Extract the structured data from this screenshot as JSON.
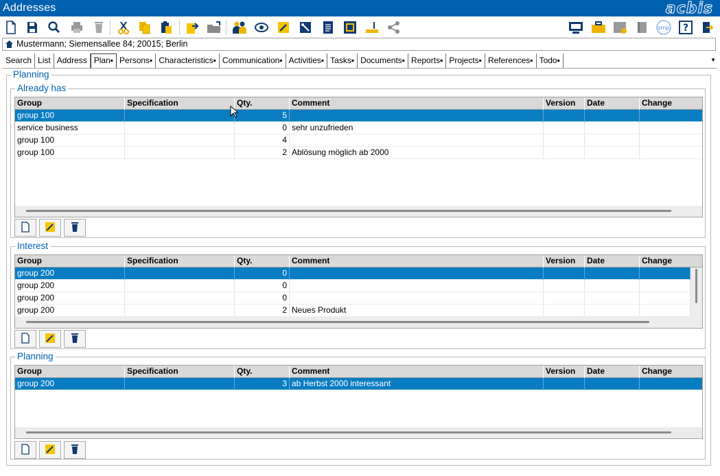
{
  "window": {
    "title": "Addresses",
    "brand": "acbis"
  },
  "breadcrumb": "Mustermann; Siemensallee 84; 20015; Berlin",
  "tabs": [
    "Search",
    "List",
    "Address",
    "Plan▪",
    "Persons▪",
    "Characteristics▪",
    "Communication▪",
    "Activities▪",
    "Tasks▪",
    "Documents▪",
    "Reports▪",
    "Projects▪",
    "References▪",
    "Todo▪"
  ],
  "active_tab": "Plan▪",
  "outer_title": "Planning",
  "columns": [
    "Group",
    "Specification",
    "Qty.",
    "Comment",
    "Version",
    "Date",
    "Change"
  ],
  "sections": {
    "already": {
      "title": "Already has",
      "rows": [
        {
          "group": "group 100",
          "spec": "",
          "qty": "5",
          "comment": "",
          "version": "",
          "date": "",
          "change": ""
        },
        {
          "group": "service business",
          "spec": "",
          "qty": "0",
          "comment": "sehr unzufrieden",
          "version": "",
          "date": "",
          "change": ""
        },
        {
          "group": "group 100",
          "spec": "",
          "qty": "4",
          "comment": "",
          "version": "",
          "date": "",
          "change": ""
        },
        {
          "group": "group 100",
          "spec": "",
          "qty": "2",
          "comment": "Ablösung möglich ab 2000",
          "version": "",
          "date": "",
          "change": ""
        }
      ]
    },
    "interest": {
      "title": "Interest",
      "rows": [
        {
          "group": "group  200",
          "spec": "",
          "qty": "0",
          "comment": "",
          "version": "",
          "date": "",
          "change": ""
        },
        {
          "group": "group  200",
          "spec": "",
          "qty": "0",
          "comment": "",
          "version": "",
          "date": "",
          "change": ""
        },
        {
          "group": "group  200",
          "spec": "",
          "qty": "0",
          "comment": "",
          "version": "",
          "date": "",
          "change": ""
        },
        {
          "group": "group  200",
          "spec": "",
          "qty": "2",
          "comment": "Neues Produkt",
          "version": "",
          "date": "",
          "change": ""
        }
      ]
    },
    "planning": {
      "title": "Planning",
      "rows": [
        {
          "group": "group  200",
          "spec": "",
          "qty": "3",
          "comment": "ab Herbst 2000 interessant",
          "version": "",
          "date": "",
          "change": ""
        }
      ]
    }
  },
  "toolbar_icons": [
    "new-document-icon",
    "save-icon",
    "search-icon",
    "print-icon",
    "delete-icon",
    "cut-icon",
    "copy-icon",
    "paste-icon",
    "export-icon",
    "open-folder-icon",
    "users-icon",
    "view-icon",
    "edit-icon",
    "tools-icon",
    "report-icon",
    "layout-icon",
    "ruler-icon",
    "share-icon",
    "monitor-icon",
    "briefcase-icon",
    "calendar-icon",
    "book-icon",
    "smp-icon",
    "help-icon",
    "exit-icon"
  ],
  "action_icons": [
    "new-icon",
    "edit-icon",
    "delete-icon"
  ],
  "colors": {
    "accent": "#0061b0",
    "selection": "#0a7dc2",
    "header": "#d9d9d9"
  }
}
